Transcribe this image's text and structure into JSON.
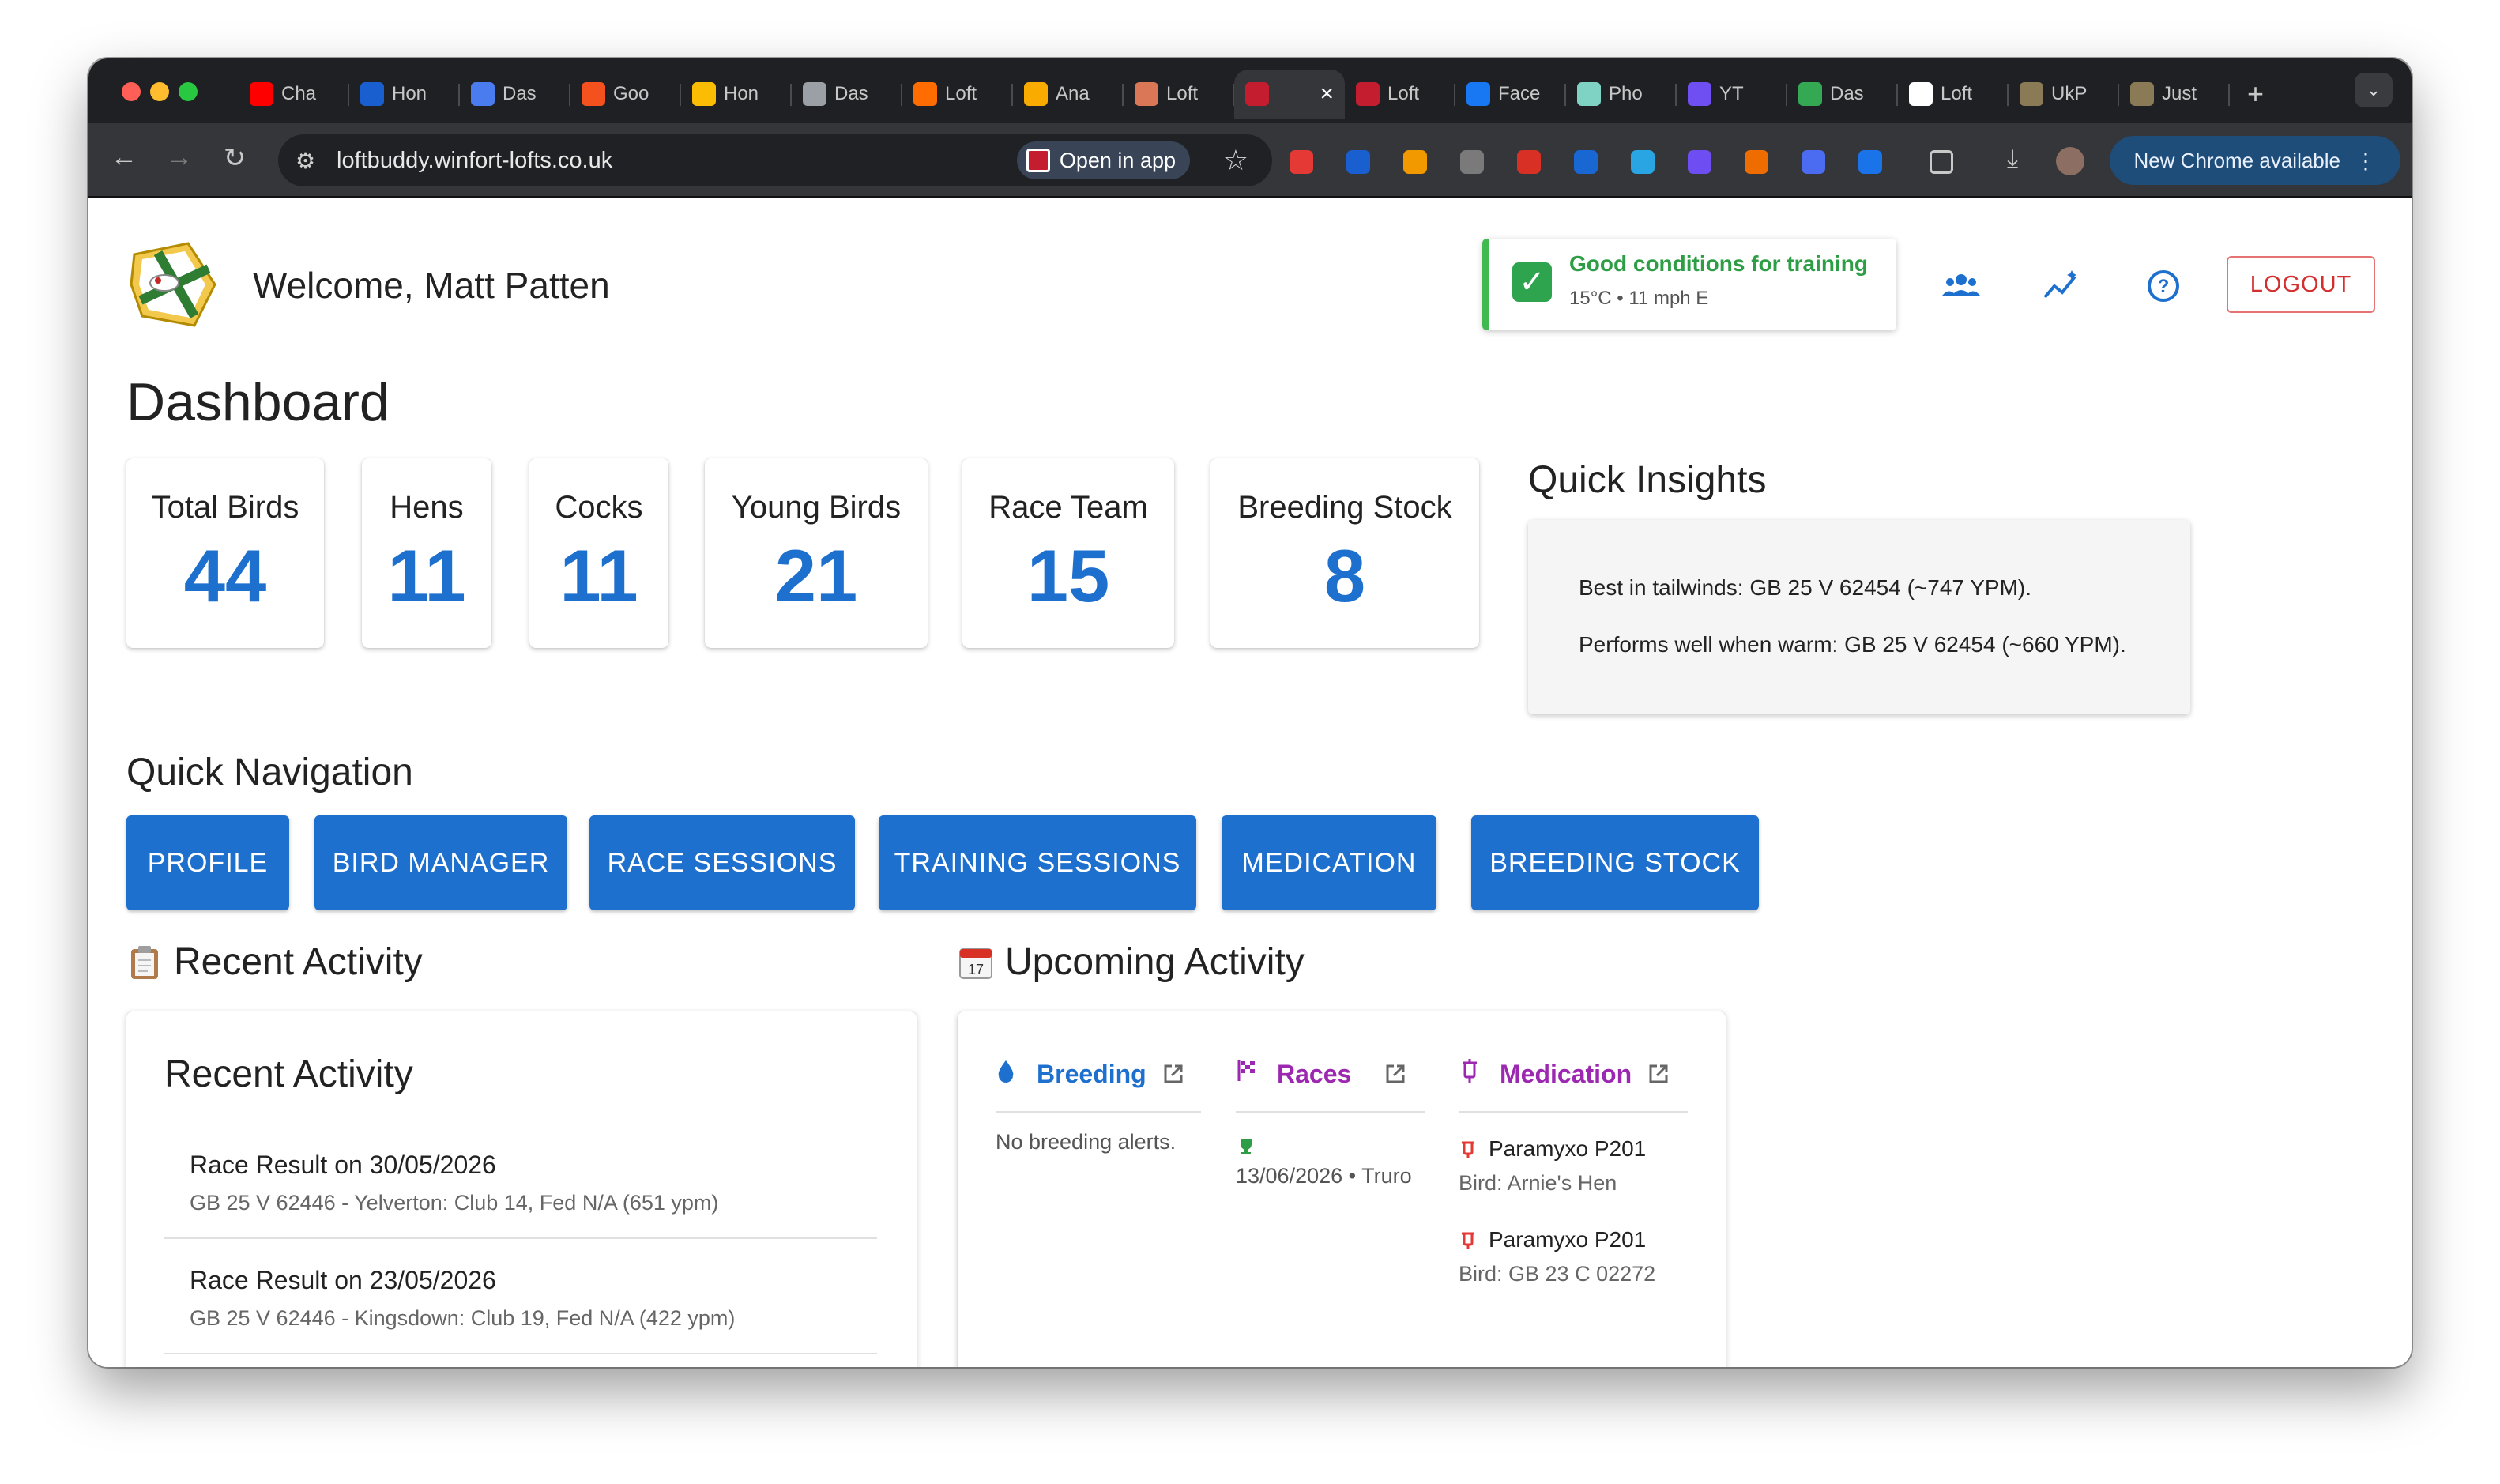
{
  "browser": {
    "tabs": [
      {
        "label": "Cha",
        "favicon_color": "#ff0000",
        "icon": "youtube-icon"
      },
      {
        "label": "Hon",
        "favicon_color": "#1a5fd0",
        "icon": "app-icon"
      },
      {
        "label": "Das",
        "favicon_color": "#4a7cf0",
        "icon": "play-icon"
      },
      {
        "label": "Goo",
        "favicon_color": "#f4511e",
        "icon": "ring-icon"
      },
      {
        "label": "Hon",
        "favicon_color": "#fbbc04",
        "icon": "ads-icon"
      },
      {
        "label": "Das",
        "favicon_color": "#9aa0a6",
        "icon": "globe-icon"
      },
      {
        "label": "Loft",
        "favicon_color": "#ff6d00",
        "icon": "flame-icon"
      },
      {
        "label": "Ana",
        "favicon_color": "#f9ab00",
        "icon": "analytics-icon"
      },
      {
        "label": "Loft",
        "favicon_color": "#d97757",
        "icon": "sparkle-icon"
      },
      {
        "label": "",
        "favicon_color": "#c51d30",
        "icon": "loftbuddy-icon",
        "active": true
      },
      {
        "label": "Loft",
        "favicon_color": "#c51d30",
        "icon": "loftbuddy-icon"
      },
      {
        "label": "Face",
        "favicon_color": "#1877f2",
        "icon": "facebook-icon"
      },
      {
        "label": "Pho",
        "favicon_color": "#7fd3c4",
        "icon": "leaf-icon"
      },
      {
        "label": "YT",
        "favicon_color": "#6f4ef2",
        "icon": "heart-icon"
      },
      {
        "label": "Das",
        "favicon_color": "#34a853",
        "icon": "pinwheel-icon"
      },
      {
        "label": "Loft",
        "favicon_color": "#ffffff",
        "icon": "openai-icon"
      },
      {
        "label": "UkP",
        "favicon_color": "#8a7a55",
        "icon": "photo-icon"
      },
      {
        "label": "Just",
        "favicon_color": "#8a7a55",
        "icon": "photo-icon"
      }
    ],
    "url": "loftbuddy.winfort-lofts.co.uk",
    "open_in_app": "Open in app",
    "new_chrome": "New Chrome available",
    "extensions": [
      "#e53935",
      "#1a5fd0",
      "#f29900",
      "#7a7a7a",
      "#d93025",
      "#1967d2",
      "#29a5e3",
      "#6e4ef2",
      "#ef6c00",
      "#4b6cf0",
      "#1a73e8"
    ]
  },
  "header": {
    "welcome": "Welcome, Matt Patten",
    "weather_title": "Good conditions for training",
    "weather_sub": "15°C • 11 mph E",
    "logout": "LOGOUT"
  },
  "dashboard": {
    "title": "Dashboard",
    "stats": [
      {
        "label": "Total Birds",
        "value": "44"
      },
      {
        "label": "Hens",
        "value": "11"
      },
      {
        "label": "Cocks",
        "value": "11"
      },
      {
        "label": "Young Birds",
        "value": "21"
      },
      {
        "label": "Race Team",
        "value": "15"
      },
      {
        "label": "Breeding Stock",
        "value": "8"
      }
    ]
  },
  "insights": {
    "title": "Quick Insights",
    "lines": [
      "Best in tailwinds: GB 25 V 62454 (~747 YPM).",
      "Performs well when warm: GB 25 V 62454 (~660 YPM)."
    ]
  },
  "navigation": {
    "title": "Quick Navigation",
    "buttons": [
      "PROFILE",
      "BIRD MANAGER",
      "RACE SESSIONS",
      "TRAINING SESSIONS",
      "MEDICATION",
      "BREEDING STOCK"
    ]
  },
  "recent": {
    "section_title": "Recent Activity",
    "card_title": "Recent Activity",
    "items": [
      {
        "title": "Race Result on 30/05/2026",
        "detail": "GB 25 V 62446 - Yelverton: Club 14, Fed N/A (651 ypm)"
      },
      {
        "title": "Race Result on 23/05/2026",
        "detail": "GB 25 V 62446 - Kingsdown: Club 19, Fed N/A (422 ypm)"
      }
    ]
  },
  "upcoming": {
    "section_title": "Upcoming Activity",
    "calendar_day": "17",
    "breeding": {
      "title": "Breeding",
      "empty": "No breeding alerts.",
      "color": "#1e70cf"
    },
    "races": {
      "title": "Races",
      "item": "13/06/2026 • Truro",
      "color": "#9c27b0"
    },
    "medication": {
      "title": "Medication",
      "color": "#9c27b0",
      "items": [
        {
          "name": "Paramyxo P201",
          "bird": "Bird: Arnie's Hen"
        },
        {
          "name": "Paramyxo P201",
          "bird": "Bird: GB 23 C 02272"
        }
      ]
    }
  }
}
